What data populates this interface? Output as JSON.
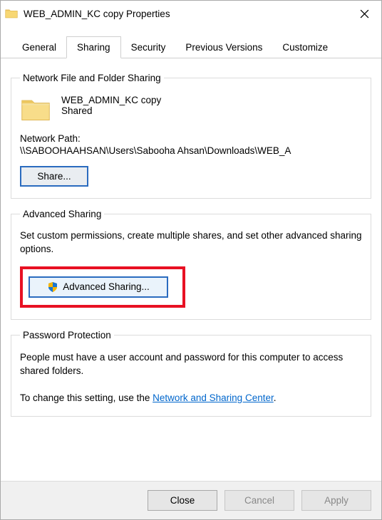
{
  "titlebar": {
    "title": "WEB_ADMIN_KC copy Properties"
  },
  "tabs": {
    "general": "General",
    "sharing": "Sharing",
    "security": "Security",
    "previous": "Previous Versions",
    "customize": "Customize"
  },
  "group_net": {
    "legend": "Network File and Folder Sharing",
    "item_name": "WEB_ADMIN_KC copy",
    "item_status": "Shared",
    "np_label": "Network Path:",
    "np_value": "\\\\SABOOHAAHSAN\\Users\\Sabooha Ahsan\\Downloads\\WEB_A",
    "share_btn": "Share..."
  },
  "group_adv": {
    "legend": "Advanced Sharing",
    "desc": "Set custom permissions, create multiple shares, and set other advanced sharing options.",
    "btn": "Advanced Sharing..."
  },
  "group_pwd": {
    "legend": "Password Protection",
    "line1": "People must have a user account and password for this computer to access shared folders.",
    "line2_prefix": "To change this setting, use the ",
    "link": "Network and Sharing Center",
    "line2_suffix": "."
  },
  "footer": {
    "close": "Close",
    "cancel": "Cancel",
    "apply": "Apply"
  }
}
